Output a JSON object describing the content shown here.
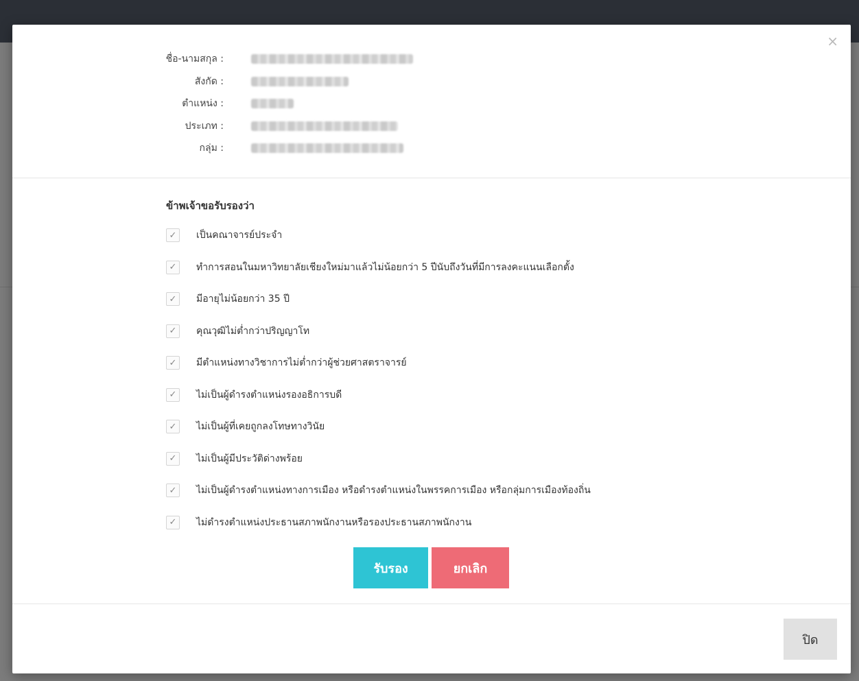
{
  "modal": {
    "close_glyph": "×",
    "profile": [
      {
        "label": "ชื่อ-นามสกุล :",
        "value": "████████████████"
      },
      {
        "label": "สังกัด :",
        "value": "██████████"
      },
      {
        "label": "ตำแหน่ง :",
        "value": "█████"
      },
      {
        "label": "ประเภท :",
        "value": "██████████████████"
      },
      {
        "label": "กลุ่ม :",
        "value": "████████████████████"
      }
    ],
    "statement_title": "ข้าพเจ้าขอรับรองว่า",
    "check_glyph": "✓",
    "criteria": [
      "เป็นคณาจารย์ประจำ",
      "ทำการสอนในมหาวิทยาลัยเชียงใหม่มาแล้วไม่น้อยกว่า 5 ปีนับถึงวันที่มีการลงคะแนนเลือกตั้ง",
      "มีอายุไม่น้อยกว่า 35 ปี",
      "คุณวุฒิไม่ต่ำกว่าปริญญาโท",
      "มีตำแหน่งทางวิชาการไม่ต่ำกว่าผู้ช่วยศาสตราจารย์",
      "ไม่เป็นผู้ดำรงตำแหน่งรองอธิการบดี",
      "ไม่เป็นผู้ที่เคยถูกลงโทษทางวินัย",
      "ไม่เป็นผู้มีประวัติด่างพร้อย",
      "ไม่เป็นผู้ดำรงตำแหน่งทางการเมือง หรือดำรงตำแหน่งในพรรคการเมือง หรือกลุ่มการเมืองท้องถิ่น",
      "ไม่ดำรงตำแหน่งประธานสภาพนักงานหรือรองประธานสภาพนักงาน"
    ],
    "buttons": {
      "confirm": "รับรอง",
      "cancel": "ยกเลิก",
      "close": "ปิด"
    },
    "colors": {
      "confirm": "#2ec4d4",
      "cancel": "#ee6b76",
      "close": "#e1e1e1"
    }
  }
}
